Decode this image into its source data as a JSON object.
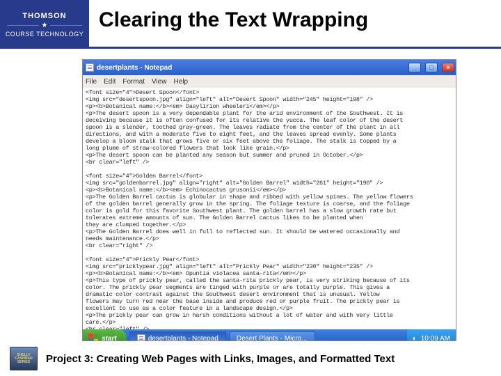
{
  "brand": {
    "name": "THOMSON",
    "subtitle": "COURSE TECHNOLOGY"
  },
  "slide": {
    "title": "Clearing the Text Wrapping",
    "footer": "Project 3: Creating Web Pages with Links, Images, and Formatted Text",
    "series": "SHELLY CASHMAN SERIES"
  },
  "window": {
    "title": "desertplants - Notepad",
    "min": "_",
    "max": "□",
    "close": "×"
  },
  "menu": {
    "file": "File",
    "edit": "Edit",
    "format": "Format",
    "view": "View",
    "help": "Help"
  },
  "notepad_text": "<font size=\"4\">Desert Spoon</font>\n<img src=\"desertspoon.jpg\" align=\"left\" alt=\"Desert Spoon\" width=\"245\" height=\"198\" />\n<p><b>Botanical name:</b><em> Dasylirion wheeleri</em></p>\n<p>The desert spoon is a very dependable plant for the arid environment of the Southwest. It is\ndeceiving because it is often confused for its relative the yucca. The leaf color of the desert\nspoon is a slender, toothed gray-green. The leaves radiate from the center of the plant in all\ndirections, and with a moderate five to eight feet, and the leaves spread evenly. Some plants\ndevelop a bloom stalk that grows five or six feet above the foliage. The stalk is topped by a\nlong plume of straw-colored flowers that look like grain.</p>\n<p>The desert spoon can be planted any season but summer and pruned in October.</p>\n<br clear=\"left\" />\n\n<font size=\"4\">Golden Barrel</font>\n<img src=\"goldenbarrel.jpg\" align=\"right\" alt=\"Golden Barrel\" width=\"261\" height=\"190\" />\n<p><b>Botanical name:</b><em> Echinocactus grusonii</em></p>\n<p>The Golden Barrel cactus is globular in shape and ribbed with yellow spines. The yellow flowers\nof the golden barrel generally grow in the spring. The foliage texture is coarse, and the foliage\ncolor is gold for this favorite Southwest plant. The golden barrel has a slow growth rate but\ntolerates extreme amounts of sun. The Golden Barrel cactus likes to be planted when\nthey are clumped together.</p>\n<p>The Golden Barrel does well in full to reflected sun. It should be watered occasionally and\nneeds maintenance.</p>\n<br clear=\"right\" />\n\n<font size=\"4\">Prickly Pear</font>\n<img src=\"pricklypear.jpg\" align=\"left\" alt=\"Prickly Pear\" width=\"230\" height=\"235\" />\n<p><b>Botanical name:</b><em> Opuntia violacea santa-rita</em></p>\n<p>This type of prickly pear, called the santa-rita prickly pear, is very striking because of its\ncolor. The prickly pear segments are tinged with purple or are totally purple. This gives a\ndramatic color contrast against the Southwest desert environment that is unusual. Yellow\nflowers may turn red near the base inside and produce red or purple fruit. The prickly pear is\nexcellent to use as a color feature in a landscape design.</p>\n<p>The prickly pear can grow in harsh conditions without a lot of water and with very little\ncare.</p>\n<br clear=\"left\" />\n\n<p>To find out more information about desert plants, visit the Arizona-Sonora Desert Museum.</p>\n</body>\n</html>",
  "taskbar": {
    "start": "start",
    "item1": "desertplants - Notepad",
    "item2": "Desert Plants - Micro...",
    "time": "10:09 AM"
  }
}
